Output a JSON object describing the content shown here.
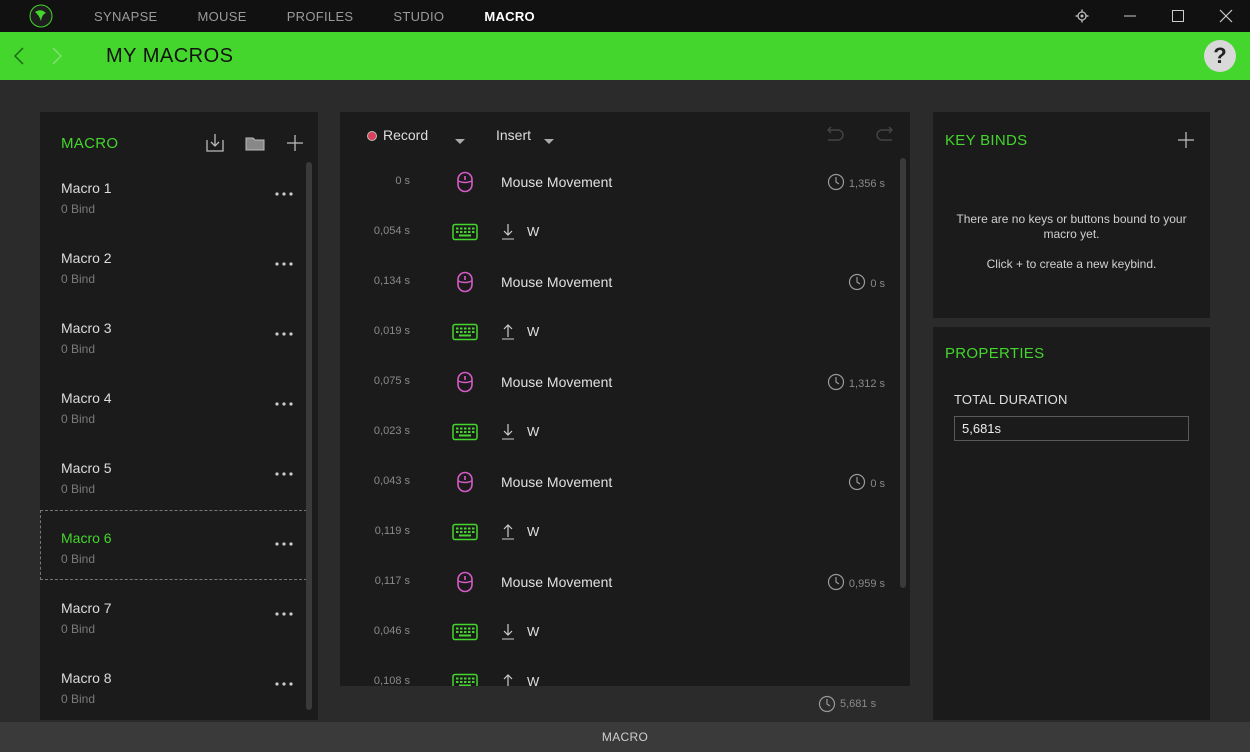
{
  "titlebar": {
    "tabs": [
      {
        "label": "SYNAPSE",
        "active": false
      },
      {
        "label": "MOUSE",
        "active": false
      },
      {
        "label": "PROFILES",
        "active": false
      },
      {
        "label": "STUDIO",
        "active": false
      },
      {
        "label": "MACRO",
        "active": true
      }
    ]
  },
  "header": {
    "title": "MY MACROS",
    "help": "?"
  },
  "colors": {
    "accent": "#44d62c",
    "mouse_icon": "#d65bc8",
    "keyboard_icon": "#44d62c"
  },
  "macro_panel": {
    "title": "MACRO",
    "items": [
      {
        "name": "Macro 1",
        "bind": "0 Bind"
      },
      {
        "name": "Macro 2",
        "bind": "0 Bind"
      },
      {
        "name": "Macro 3",
        "bind": "0 Bind"
      },
      {
        "name": "Macro 4",
        "bind": "0 Bind"
      },
      {
        "name": "Macro 5",
        "bind": "0 Bind"
      },
      {
        "name": "Macro 6",
        "bind": "0 Bind"
      },
      {
        "name": "Macro 7",
        "bind": "0 Bind"
      },
      {
        "name": "Macro 8",
        "bind": "0 Bind"
      }
    ],
    "selected": "Macro 6"
  },
  "editor": {
    "record_label": "Record",
    "insert_label": "Insert",
    "events": [
      {
        "delay": "0 s",
        "type": "mouse",
        "label": "Mouse Movement",
        "duration": "1,356 s"
      },
      {
        "delay": "0,054 s",
        "type": "key",
        "direction": "down",
        "label": "W"
      },
      {
        "delay": "0,134 s",
        "type": "mouse",
        "label": "Mouse Movement",
        "duration": "0 s"
      },
      {
        "delay": "0,019 s",
        "type": "key",
        "direction": "up",
        "label": "W"
      },
      {
        "delay": "0,075 s",
        "type": "mouse",
        "label": "Mouse Movement",
        "duration": "1,312 s"
      },
      {
        "delay": "0,023 s",
        "type": "key",
        "direction": "down",
        "label": "W"
      },
      {
        "delay": "0,043 s",
        "type": "mouse",
        "label": "Mouse Movement",
        "duration": "0 s"
      },
      {
        "delay": "0,119 s",
        "type": "key",
        "direction": "up",
        "label": "W"
      },
      {
        "delay": "0,117 s",
        "type": "mouse",
        "label": "Mouse Movement",
        "duration": "0,959 s"
      },
      {
        "delay": "0,046 s",
        "type": "key",
        "direction": "down",
        "label": "W"
      },
      {
        "delay": "0,108 s",
        "type": "key",
        "direction": "up",
        "label": "W"
      }
    ],
    "total": "5,681 s"
  },
  "keybinds": {
    "title": "KEY BINDS",
    "empty_message": "There are no keys or buttons bound to your macro yet.",
    "hint": "Click + to create a new keybind."
  },
  "properties": {
    "title": "PROPERTIES",
    "total_duration_label": "TOTAL DURATION",
    "total_duration_value": "5,681s"
  },
  "status_bar": {
    "label": "MACRO"
  }
}
